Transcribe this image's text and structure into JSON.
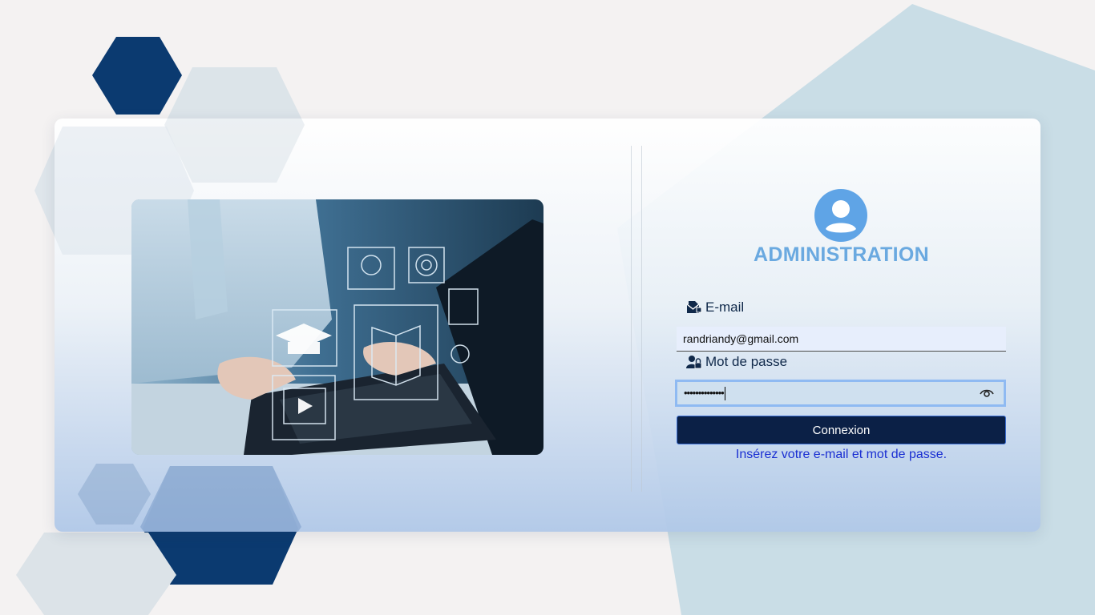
{
  "login": {
    "title": "ADMINISTRATION",
    "email_label": "E-mail",
    "email_value": "randriandy@gmail.com",
    "password_label": "Mot de passe",
    "password_value": "••••••••••••••",
    "submit_label": "Connexion",
    "hint": "Insérez votre e-mail et mot de passe."
  },
  "icons": {
    "avatar": "user-circle-icon",
    "email": "envelope-icon",
    "password": "user-lock-icon",
    "toggle_password": "eye-icon"
  },
  "colors": {
    "title": "#6aa9e0",
    "button": "#0b2046",
    "hint": "#1a2fd2",
    "hex_dark": "#0b3a70",
    "hex_light": "#d6e2ea"
  }
}
